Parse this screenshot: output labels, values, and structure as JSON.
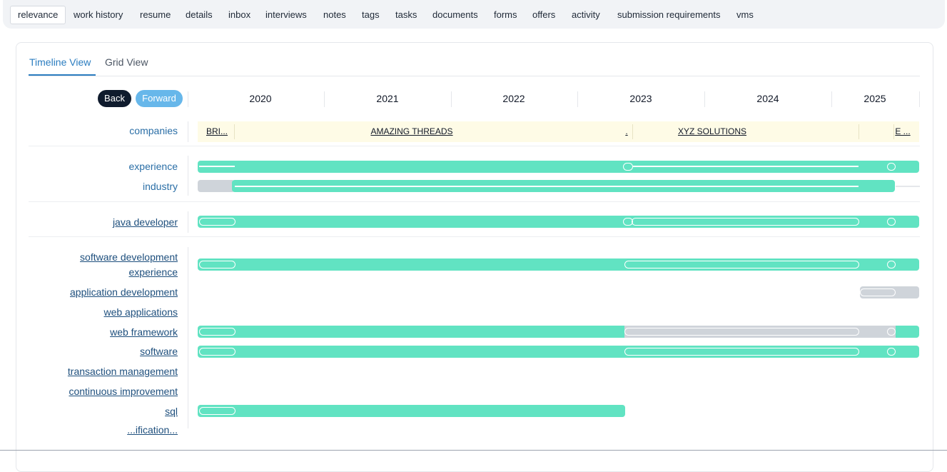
{
  "nav": {
    "tabs": [
      "relevance",
      "work history",
      "resume",
      "details",
      "inbox",
      "interviews",
      "notes",
      "tags",
      "tasks",
      "documents",
      "forms",
      "offers",
      "activity",
      "submission requirements",
      "vms"
    ],
    "active": "relevance"
  },
  "timeline": {
    "view_tabs": [
      "Timeline View",
      "Grid View"
    ],
    "active_view": "Timeline View",
    "back_label": "Back",
    "forward_label": "Forward",
    "years": [
      "2020",
      "2021",
      "2022",
      "2023",
      "2024",
      "2025"
    ],
    "companies_label": "companies",
    "companies": [
      "BRI...",
      "AMAZING THREADS",
      ".",
      "XYZ SOLUTIONS",
      "E ..."
    ],
    "rows": {
      "experience": "experience",
      "industry": "industry",
      "java_developer": "java developer",
      "software_development_experience_1": "software development",
      "software_development_experience_2": "experience",
      "application_development": "application development",
      "web_applications": "web applications",
      "web_framework": "web framework",
      "software": "software",
      "transaction_management": "transaction management",
      "continuous_improvement": "continuous improvement",
      "sql": "sql",
      "cutoff": "...ification..."
    },
    "colors": {
      "match": "#61e3c2",
      "partial": "#cfd4da",
      "accent": "#2b7dc0",
      "company_band": "#fefbe6"
    }
  }
}
